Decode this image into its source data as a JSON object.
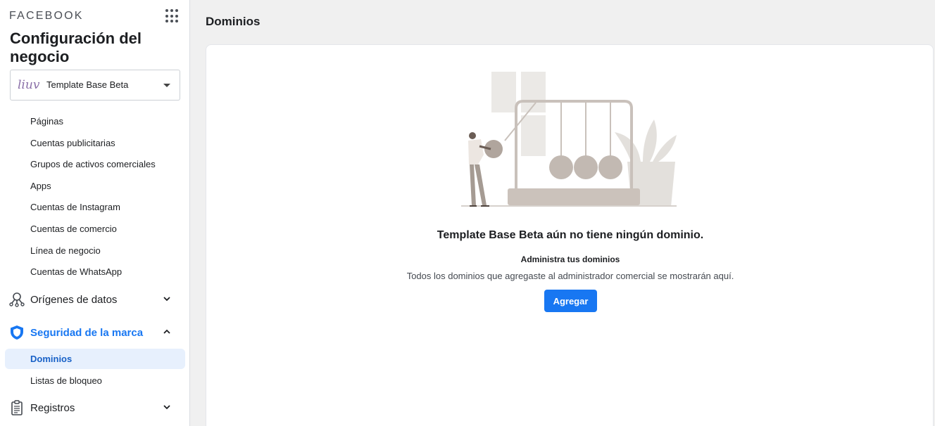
{
  "sidebar": {
    "brand": "FACEBOOK",
    "title": "Configuración del negocio",
    "account": {
      "logo_text": "liuv",
      "name": "Template Base Beta"
    },
    "accounts_items": [
      {
        "label": "Páginas"
      },
      {
        "label": "Cuentas publicitarias"
      },
      {
        "label": "Grupos de activos comerciales"
      },
      {
        "label": "Apps"
      },
      {
        "label": "Cuentas de Instagram"
      },
      {
        "label": "Cuentas de comercio"
      },
      {
        "label": "Línea de negocio"
      },
      {
        "label": "Cuentas de WhatsApp"
      }
    ],
    "sections": [
      {
        "label": "Orígenes de datos",
        "icon": "data-sources-icon",
        "expanded": false
      },
      {
        "label": "Seguridad de la marca",
        "icon": "shield-icon",
        "expanded": true
      },
      {
        "label": "Registros",
        "icon": "clipboard-icon",
        "expanded": false
      }
    ],
    "brand_safety_items": [
      {
        "label": "Dominios",
        "selected": true
      },
      {
        "label": "Listas de bloqueo",
        "selected": false
      }
    ]
  },
  "main": {
    "title": "Dominios",
    "empty_state": {
      "title": "Template Base Beta aún no tiene ningún dominio.",
      "subtitle": "Administra tus dominios",
      "description": "Todos los dominios que agregaste al administrador comercial se mostrarán aquí.",
      "button_label": "Agregar"
    }
  },
  "colors": {
    "accent": "#1877f2",
    "selected_bg": "#e7f0fd",
    "page_bg": "#f0f0f0"
  }
}
